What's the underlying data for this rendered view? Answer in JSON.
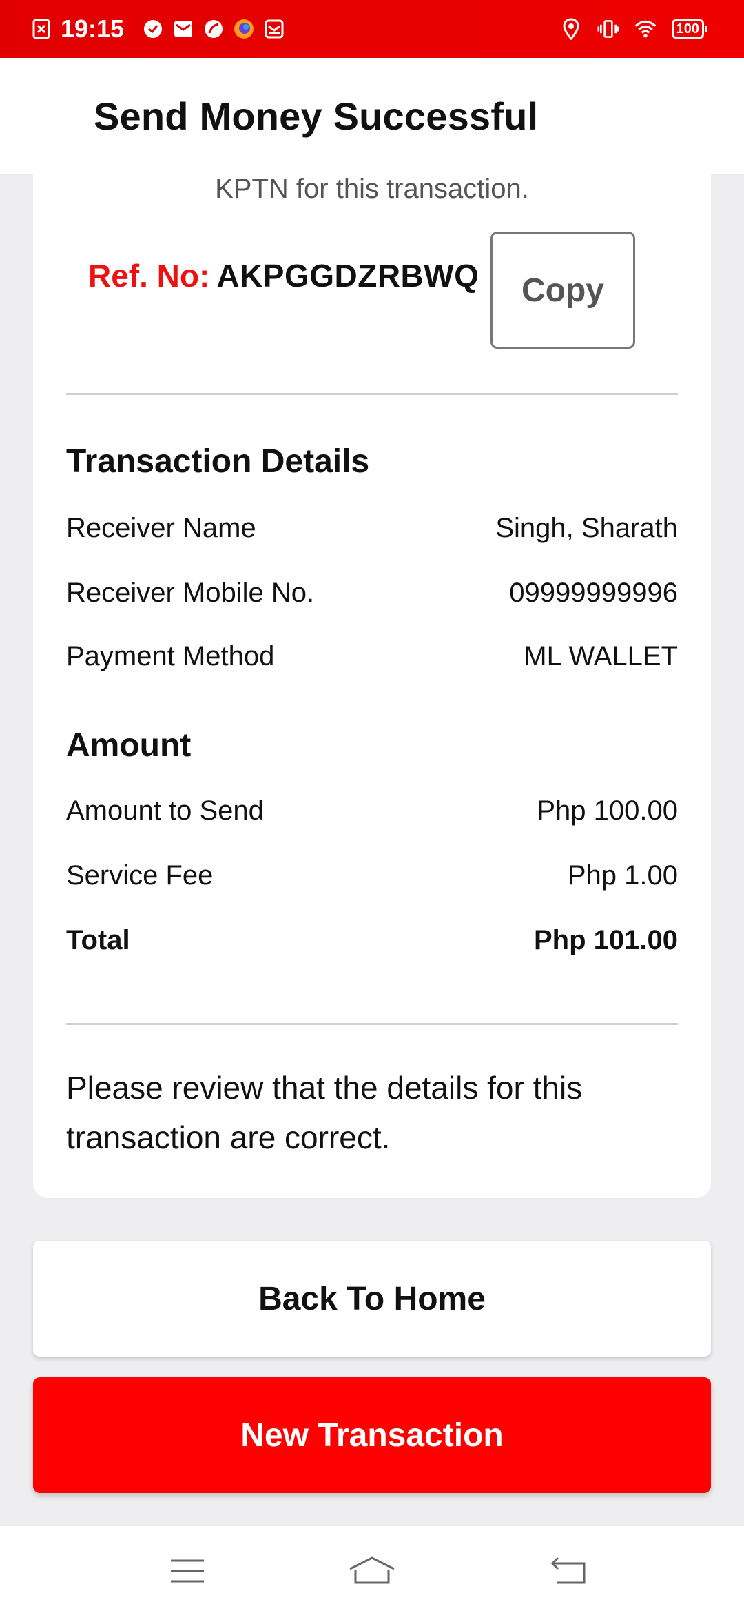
{
  "status_bar": {
    "time": "19:15",
    "battery": "100",
    "icons": [
      "sim-card-icon",
      "check-circle-icon",
      "mail-icon",
      "leaf-icon",
      "firefox-icon",
      "inbox-icon",
      "location-icon",
      "vibrate-icon",
      "wifi-icon",
      "battery-icon"
    ]
  },
  "header": {
    "title": "Send Money Successful"
  },
  "card": {
    "kptn_note": "KPTN for this transaction.",
    "ref_label": "Ref. No:",
    "ref_value": "AKPGGDZRBWQ",
    "copy_label": "Copy",
    "transaction_details": {
      "title": "Transaction Details",
      "rows": [
        {
          "label": "Receiver Name",
          "value": "Singh, Sharath"
        },
        {
          "label": "Receiver Mobile No.",
          "value": "09999999996"
        },
        {
          "label": "Payment Method",
          "value": "ML WALLET"
        }
      ]
    },
    "amount": {
      "title": "Amount",
      "rows": [
        {
          "label": "Amount to Send",
          "value": "Php 100.00"
        },
        {
          "label": "Service Fee",
          "value": "Php 1.00"
        },
        {
          "label": "Total",
          "value": "Php 101.00"
        }
      ]
    },
    "review_note": "Please review that the details for this transaction are correct."
  },
  "buttons": {
    "back_home": "Back To Home",
    "new_transaction": "New Transaction"
  },
  "nav_bar": {
    "icons": [
      "menu-icon",
      "home-icon",
      "back-icon"
    ]
  },
  "colors": {
    "brand_red": "#ff0000",
    "status_red": "#e10000",
    "ref_label_red": "#ee1111"
  }
}
